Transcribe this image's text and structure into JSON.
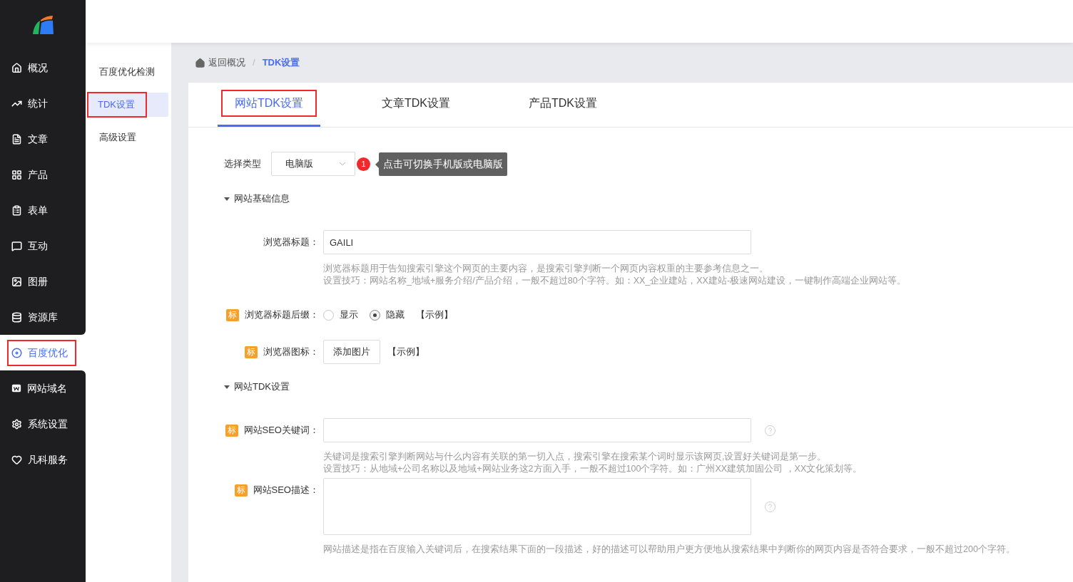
{
  "nav": {
    "items": [
      {
        "label": "概况",
        "selected": false,
        "highlighted": false
      },
      {
        "label": "统计",
        "selected": false,
        "highlighted": false
      },
      {
        "label": "文章",
        "selected": false,
        "highlighted": false
      },
      {
        "label": "产品",
        "selected": false,
        "highlighted": false
      },
      {
        "label": "表单",
        "selected": false,
        "highlighted": false
      },
      {
        "label": "互动",
        "selected": false,
        "highlighted": false
      },
      {
        "label": "图册",
        "selected": false,
        "highlighted": false
      },
      {
        "label": "资源库",
        "selected": false,
        "highlighted": false
      },
      {
        "label": "百度优化",
        "selected": true,
        "highlighted": true
      },
      {
        "label": "网站域名",
        "selected": false,
        "highlighted": false
      },
      {
        "label": "系统设置",
        "selected": false,
        "highlighted": false
      },
      {
        "label": "凡科服务",
        "selected": false,
        "highlighted": false
      }
    ]
  },
  "submenu": {
    "items": [
      {
        "label": "百度优化检测",
        "selected": false,
        "highlighted": false
      },
      {
        "label": "TDK设置",
        "selected": true,
        "highlighted": true
      },
      {
        "label": "高级设置",
        "selected": false,
        "highlighted": false
      }
    ]
  },
  "breadcrumb": {
    "back": "返回概况",
    "separator": "/",
    "current": "TDK设置"
  },
  "tabs": [
    {
      "label": "网站TDK设置",
      "selected": true,
      "highlighted": true
    },
    {
      "label": "文章TDK设置",
      "selected": false,
      "highlighted": false
    },
    {
      "label": "产品TDK设置",
      "selected": false,
      "highlighted": false
    }
  ],
  "type_select": {
    "label": "选择类型",
    "value": "电脑版",
    "callout": {
      "badge": "1",
      "text": "点击可切换手机版或电脑版"
    }
  },
  "sections": [
    {
      "title": "网站基础信息",
      "expanded": true,
      "fields": [
        {
          "kind": "input",
          "label": "浏览器标题：",
          "value": "GAILI",
          "hints": [
            "浏览器标题用于告知搜索引擎这个网页的主要内容，是搜索引擎判断一个网页内容权重的主要参考信息之一。",
            "设置技巧：网站名称_地域+服务介绍/产品介绍，一般不超过80个字符。如：XX_企业建站，XX建站-极速网站建设，一键制作高端企业网站等。"
          ]
        },
        {
          "kind": "radio",
          "tag": "标",
          "label": "浏览器标题后缀：",
          "options": [
            {
              "label": "显示",
              "selected": false
            },
            {
              "label": "隐藏",
              "selected": true
            }
          ],
          "example": "【示例】"
        },
        {
          "kind": "upload",
          "tag": "标",
          "label": "浏览器图标：",
          "button": "添加图片",
          "example": "【示例】"
        }
      ]
    },
    {
      "title": "网站TDK设置",
      "expanded": true,
      "fields": [
        {
          "kind": "input",
          "tag": "标",
          "label": "网站SEO关键词：",
          "help": true,
          "hints": [
            "关键词是搜索引擎判断网站与什么内容有关联的第一切入点，搜索引擎在搜索某个词时显示该网页,设置好关键词是第一步。",
            "设置技巧：从地域+公司名称以及地域+网站业务这2方面入手，一般不超过100个字符。如：广州XX建筑加固公司 ，XX文化策划等。"
          ]
        },
        {
          "kind": "textarea",
          "tag": "标",
          "label": "网站SEO描述：",
          "help": true,
          "hints": [
            "网站描述是指在百度输入关键词后，在搜索结果下面的一段描述，好的描述可以帮助用户更方便地从搜索结果中判断你的网页内容是否符合要求，一般不超过200个字符。"
          ]
        }
      ]
    }
  ]
}
